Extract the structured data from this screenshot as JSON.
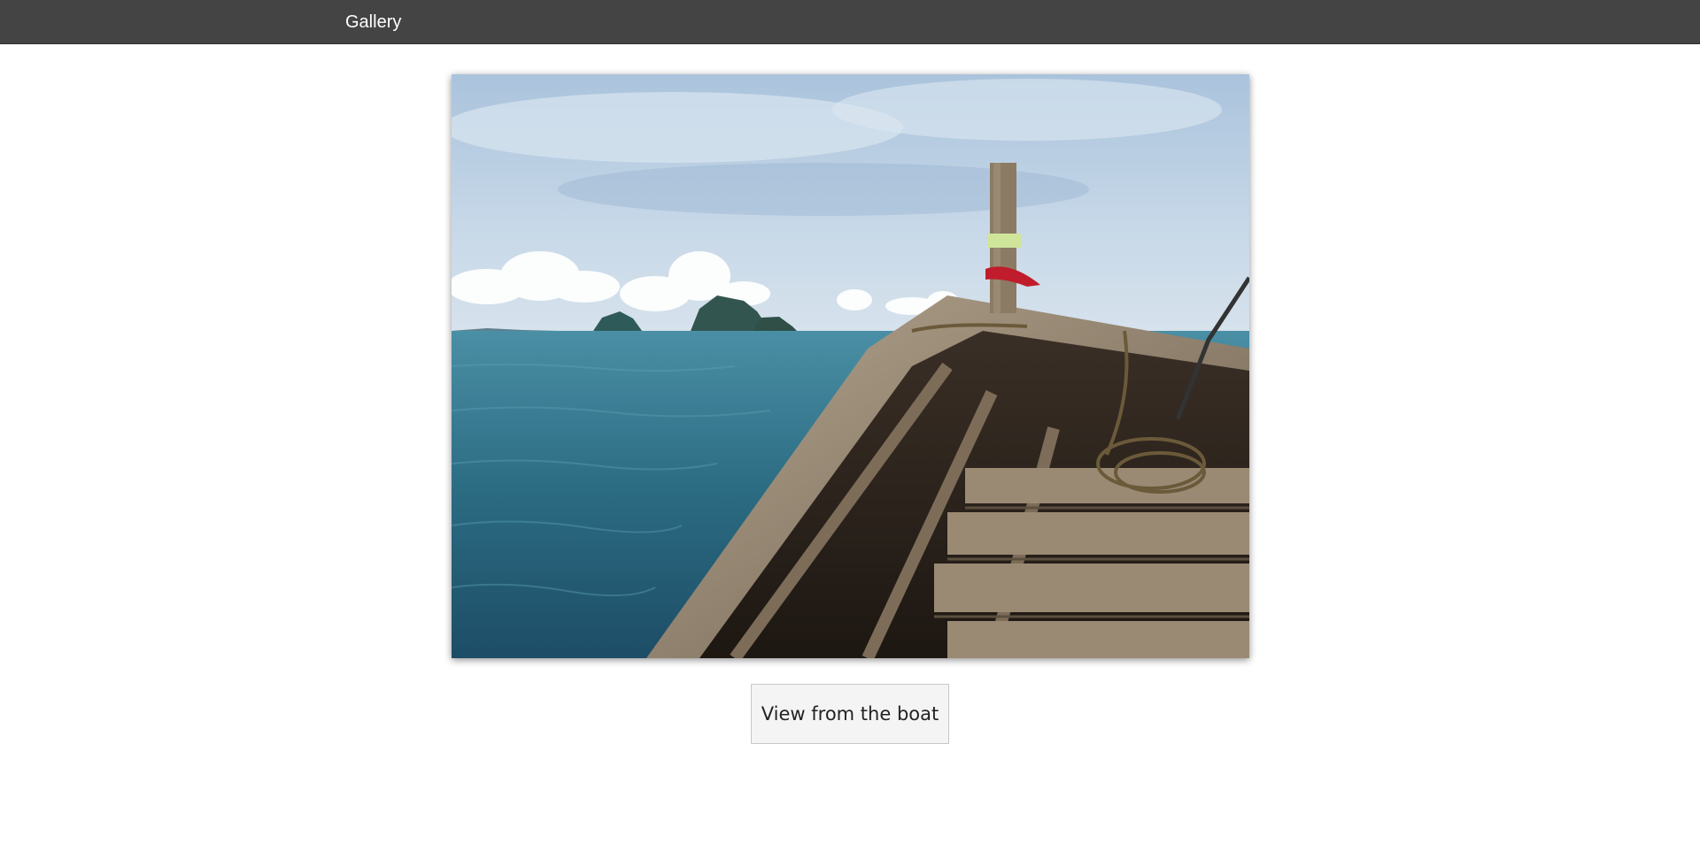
{
  "header": {
    "title": "Gallery"
  },
  "gallery": {
    "photo": {
      "subject": "boat-bow-sea-islands"
    },
    "caption_button_label": "View from the boat"
  },
  "colors": {
    "topbar": "#444444",
    "sky": "#b7cde3",
    "sea": "#2b6b82",
    "wood": "#8a7a66"
  }
}
